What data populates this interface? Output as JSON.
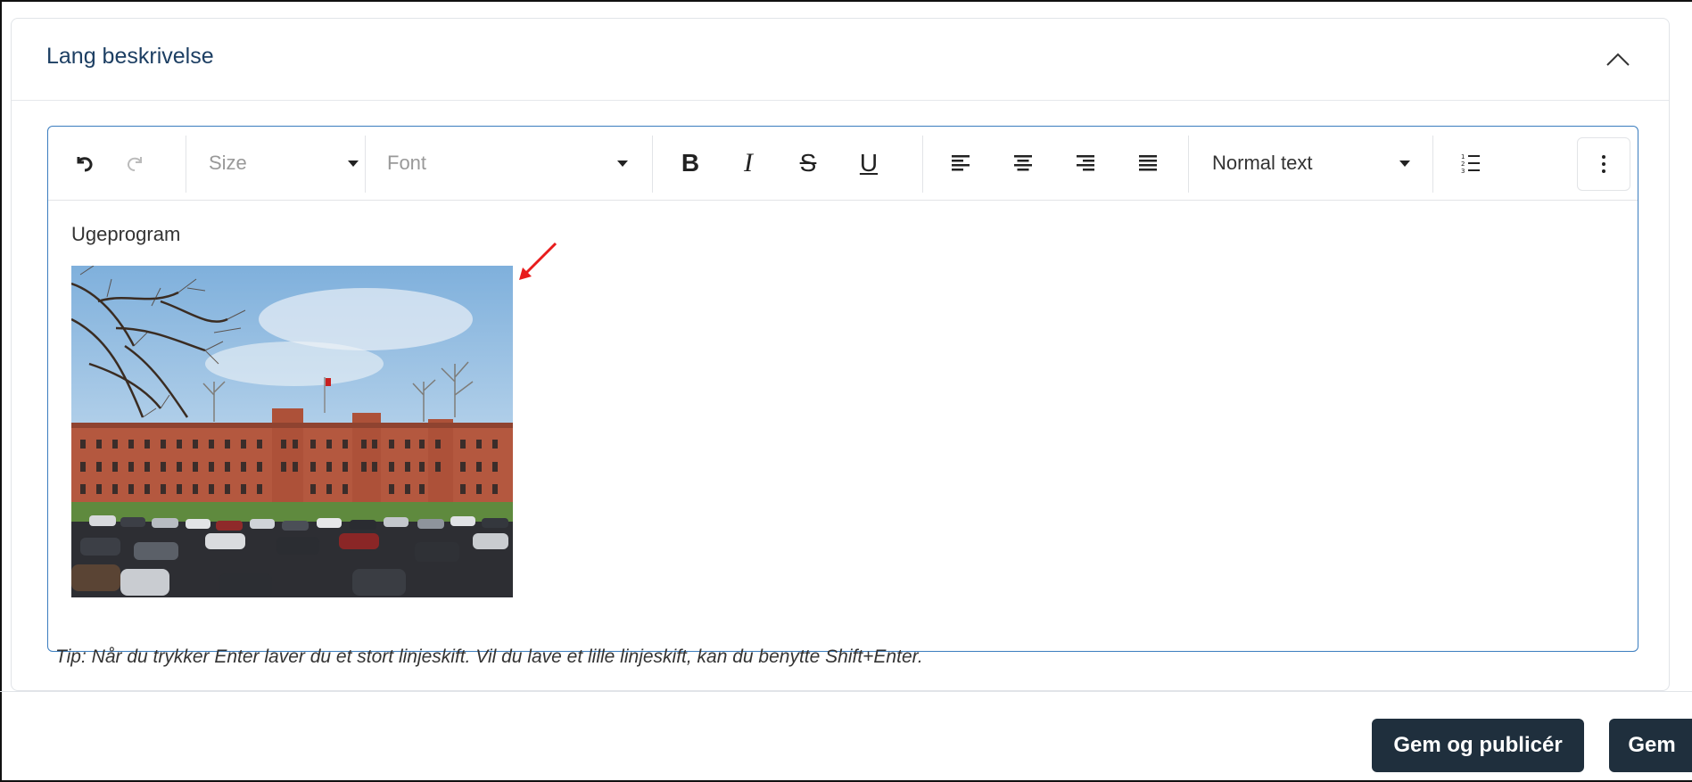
{
  "panel": {
    "title": "Lang beskrivelse"
  },
  "toolbar": {
    "size_label": "Size",
    "font_label": "Font",
    "bold_label": "B",
    "italic_label": "I",
    "strike_label": "S",
    "underline_label": "U",
    "block_label": "Normal text",
    "icons": [
      "undo-icon",
      "redo-icon",
      "align-left-icon",
      "align-center-icon",
      "align-right-icon",
      "align-justify-icon",
      "ordered-list-icon",
      "more-vertical-icon"
    ]
  },
  "editor": {
    "paragraph": "Ugeprogram"
  },
  "tip": "Tip: Når du trykker Enter laver du et stort linjeskift. Vil du lave et lille linjeskift, kan du benytte Shift+Enter.",
  "actions": {
    "publish_label": "Gem og publicér",
    "save_label": "Gem"
  },
  "colors": {
    "title": "#1d3f63",
    "editor_border": "#3b7dbf",
    "button_bg": "#1f2f3d",
    "annotation_arrow": "#e81c1c"
  }
}
